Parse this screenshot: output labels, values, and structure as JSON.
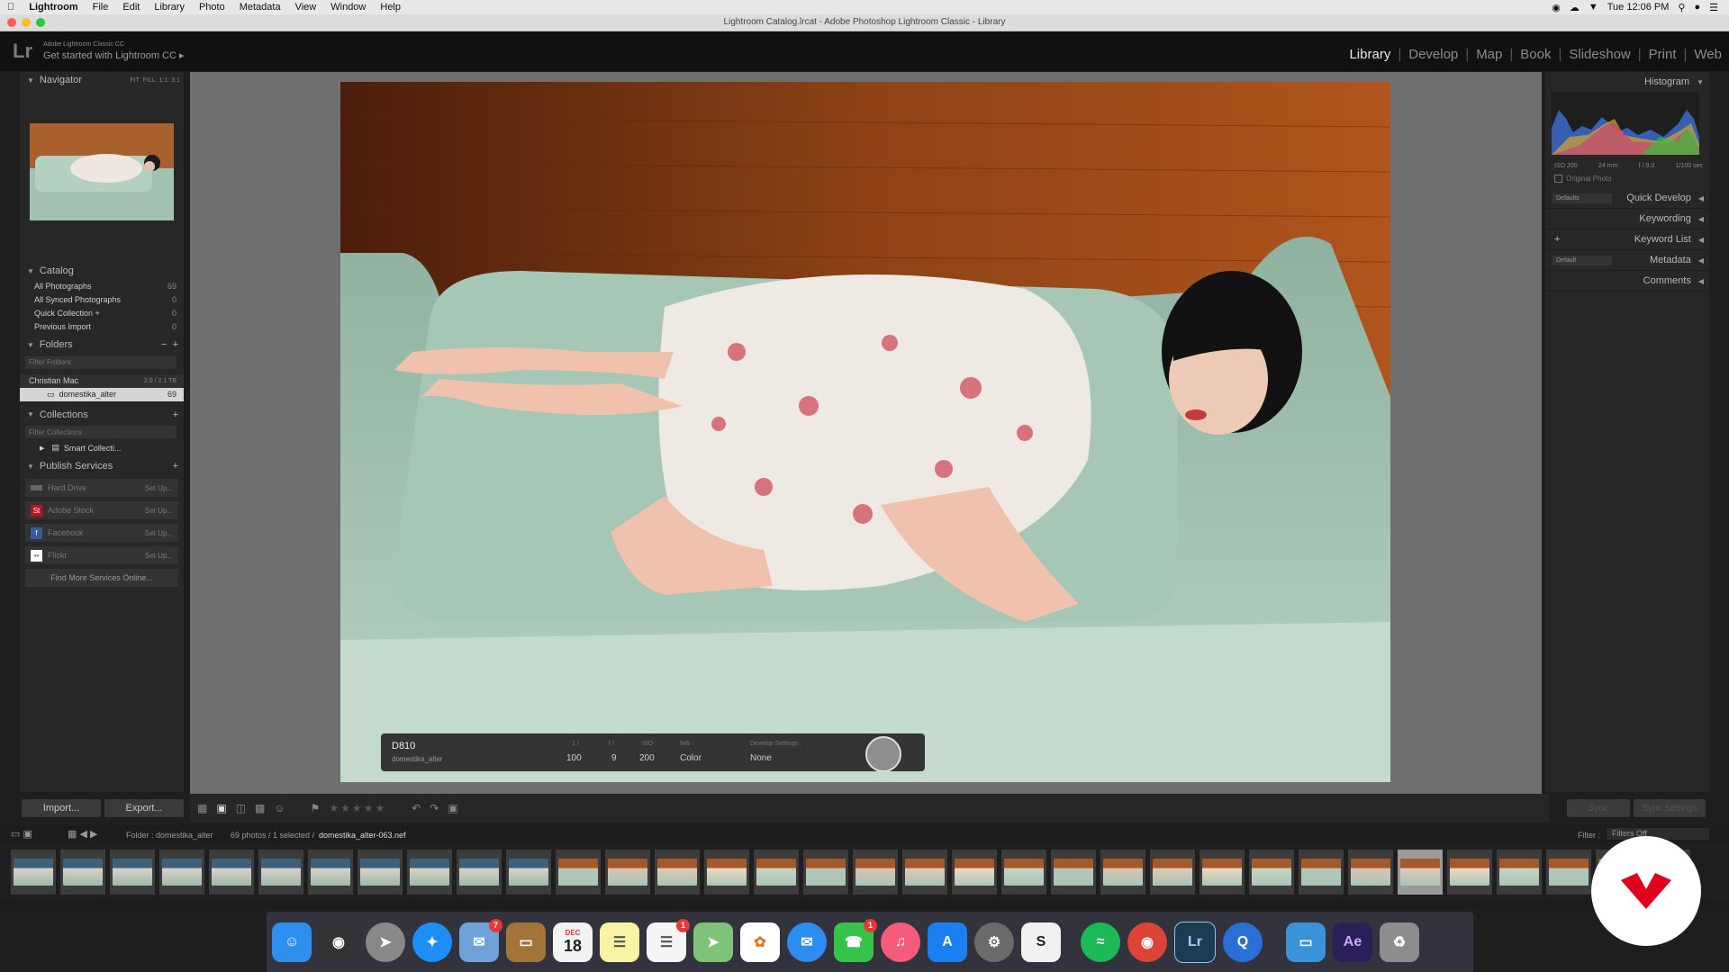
{
  "menubar": {
    "app": "Lightroom",
    "items": [
      "File",
      "Edit",
      "Library",
      "Photo",
      "Metadata",
      "View",
      "Window",
      "Help"
    ],
    "clock": "Tue 12:06 PM"
  },
  "window_title": "Lightroom Catalog.lrcat - Adobe Photoshop Lightroom Classic - Library",
  "lr_header": {
    "logo": "Lr",
    "product": "Adobe Lightroom Classic CC",
    "cta": "Get started with Lightroom CC",
    "cta_arrow": "▸",
    "modules": [
      "Library",
      "Develop",
      "Map",
      "Book",
      "Slideshow",
      "Print",
      "Web"
    ],
    "active_module": "Library"
  },
  "navigator": {
    "title": "Navigator",
    "zoom_options": [
      "FIT",
      "FILL",
      "1:1",
      "3:1"
    ]
  },
  "catalog": {
    "title": "Catalog",
    "items": [
      {
        "label": "All Photographs",
        "count": "69"
      },
      {
        "label": "All Synced Photographs",
        "count": "0"
      },
      {
        "label": "Quick Collection +",
        "count": "0"
      },
      {
        "label": "Previous Import",
        "count": "0"
      }
    ]
  },
  "folders": {
    "title": "Folders",
    "filter_placeholder": "Filter Folders",
    "volume": {
      "label": "Christian Mac",
      "size": "2.0 / 2.1 TB"
    },
    "folder": {
      "label": "domestika_alter",
      "count": "69"
    }
  },
  "collections": {
    "title": "Collections",
    "filter_placeholder": "Filter Collections",
    "smart": "Smart Collecti..."
  },
  "publish": {
    "title": "Publish Services",
    "services": [
      {
        "label": "Hard Drive",
        "action": "Set Up...",
        "icon": "hard-drive-icon",
        "color": "#666666",
        "glyph": ""
      },
      {
        "label": "Adobe Stock",
        "action": "Set Up...",
        "icon": "adobe-stock-icon",
        "color": "#b3161c",
        "glyph": "St"
      },
      {
        "label": "Facebook",
        "action": "Set Up...",
        "icon": "facebook-icon",
        "color": "#3b5998",
        "glyph": "f"
      },
      {
        "label": "Flickr",
        "action": "Set Up...",
        "icon": "flickr-icon",
        "color": "#ffffff",
        "glyph": "••"
      }
    ],
    "find_more": "Find More Services Online..."
  },
  "left_buttons": {
    "import": "Import...",
    "export": "Export..."
  },
  "right_panel": {
    "histogram": "Histogram",
    "exif": [
      "ISO 200",
      "24 mm",
      "f / 9.0",
      "1/100 sec"
    ],
    "original_photo": "Original Photo",
    "quick_develop": "Quick Develop",
    "defaults": "Defaults",
    "keywording": "Keywording",
    "keyword_list": "Keyword List",
    "metadata": "Metadata",
    "metadata_preset": "Default",
    "comments": "Comments",
    "sync": "Sync",
    "sync_settings": "Sync Settings"
  },
  "info_overlay": {
    "camera": "D810",
    "folder": "domestika_alter",
    "shutter_label": "1 /",
    "shutter": "100",
    "aperture_label": "f /",
    "aperture": "9",
    "iso_label": "ISO",
    "iso": "200",
    "wb_label": "WB :",
    "wb": "Color",
    "dev_label": "Develop Settings :",
    "dev": "None"
  },
  "filmstrip_bar": {
    "folder": "Folder : domestika_alter",
    "count": "69 photos / 1 selected /",
    "file": "domestika_alter-063.nef",
    "filter_label": "Filter :",
    "filter_value": "Filters Off"
  },
  "dock": {
    "calendar_month": "DEC",
    "calendar_day": "18",
    "badges": {
      "mail": "7",
      "reminders": "1",
      "facetime": "1"
    }
  },
  "colors": {
    "accent": "#e8e8e8",
    "panel": "#272727",
    "background": "#1e1e1e"
  }
}
